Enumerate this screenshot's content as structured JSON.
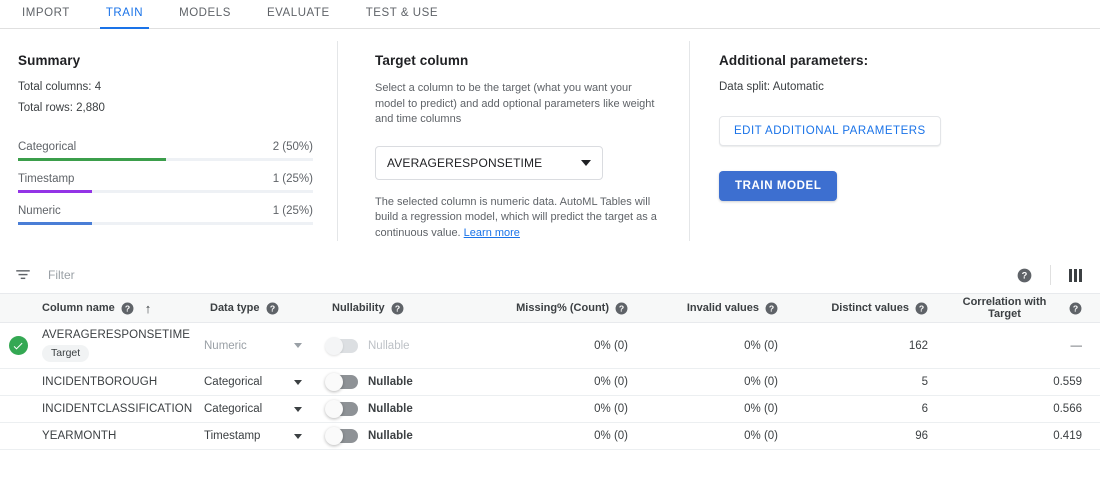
{
  "tabs": [
    {
      "label": "IMPORT",
      "active": false
    },
    {
      "label": "TRAIN",
      "active": true
    },
    {
      "label": "MODELS",
      "active": false
    },
    {
      "label": "EVALUATE",
      "active": false
    },
    {
      "label": "TEST & USE",
      "active": false
    }
  ],
  "summary": {
    "title": "Summary",
    "total_columns": "Total columns: 4",
    "total_rows": "Total rows: 2,880",
    "bars": [
      {
        "label": "Categorical",
        "value": "2 (50%)",
        "pct": 50,
        "color": "#3b9e4b"
      },
      {
        "label": "Timestamp",
        "value": "1 (25%)",
        "pct": 25,
        "color": "#9334e6"
      },
      {
        "label": "Numeric",
        "value": "1 (25%)",
        "pct": 25,
        "color": "#4a7ed6"
      }
    ]
  },
  "target_column": {
    "title": "Target column",
    "description": "Select a column to be the target (what you want your model to predict) and add optional parameters like weight and time columns",
    "selected": "AVERAGERESPONSETIME",
    "hint_text": "The selected column is numeric data. AutoML Tables will build a regression model, which will predict the target as a continuous value. ",
    "hint_link": "Learn more"
  },
  "additional_parameters": {
    "title": "Additional parameters:",
    "data_split": "Data split: Automatic",
    "edit_button": "EDIT ADDITIONAL PARAMETERS",
    "train_button": "TRAIN MODEL"
  },
  "filter": {
    "placeholder": "Filter"
  },
  "table": {
    "headers": [
      {
        "label": "Column name",
        "help": true,
        "sorted": true,
        "align": "left"
      },
      {
        "label": "Data type",
        "help": true,
        "sorted": false,
        "align": "left"
      },
      {
        "label": "Nullability",
        "help": true,
        "sorted": false,
        "align": "left"
      },
      {
        "label": "Missing% (Count)",
        "help": true,
        "sorted": false,
        "align": "right"
      },
      {
        "label": "Invalid values",
        "help": true,
        "sorted": false,
        "align": "right"
      },
      {
        "label": "Distinct values",
        "help": true,
        "sorted": false,
        "align": "right"
      },
      {
        "label": "Correlation with Target",
        "help": true,
        "sorted": false,
        "align": "right"
      }
    ],
    "rows": [
      {
        "is_target": true,
        "chip": "Target",
        "name": "AVERAGERESPONSETIME",
        "data_type": "Numeric",
        "type_disabled": true,
        "nullability": "Nullable",
        "nullable_disabled": true,
        "missing": "0% (0)",
        "invalid": "0% (0)",
        "distinct": "162",
        "correlation": "—"
      },
      {
        "is_target": false,
        "chip": "",
        "name": "INCIDENTBOROUGH",
        "data_type": "Categorical",
        "type_disabled": false,
        "nullability": "Nullable",
        "nullable_disabled": false,
        "missing": "0% (0)",
        "invalid": "0% (0)",
        "distinct": "5",
        "correlation": "0.559"
      },
      {
        "is_target": false,
        "chip": "",
        "name": "INCIDENTCLASSIFICATION",
        "data_type": "Categorical",
        "type_disabled": false,
        "nullability": "Nullable",
        "nullable_disabled": false,
        "missing": "0% (0)",
        "invalid": "0% (0)",
        "distinct": "6",
        "correlation": "0.566"
      },
      {
        "is_target": false,
        "chip": "",
        "name": "YEARMONTH",
        "data_type": "Timestamp",
        "type_disabled": false,
        "nullability": "Nullable",
        "nullable_disabled": false,
        "missing": "0% (0)",
        "invalid": "0% (0)",
        "distinct": "96",
        "correlation": "0.419"
      }
    ]
  },
  "colors": {
    "accent": "#1a73e8",
    "primary_button": "#3d6fd0",
    "success": "#34a853"
  }
}
